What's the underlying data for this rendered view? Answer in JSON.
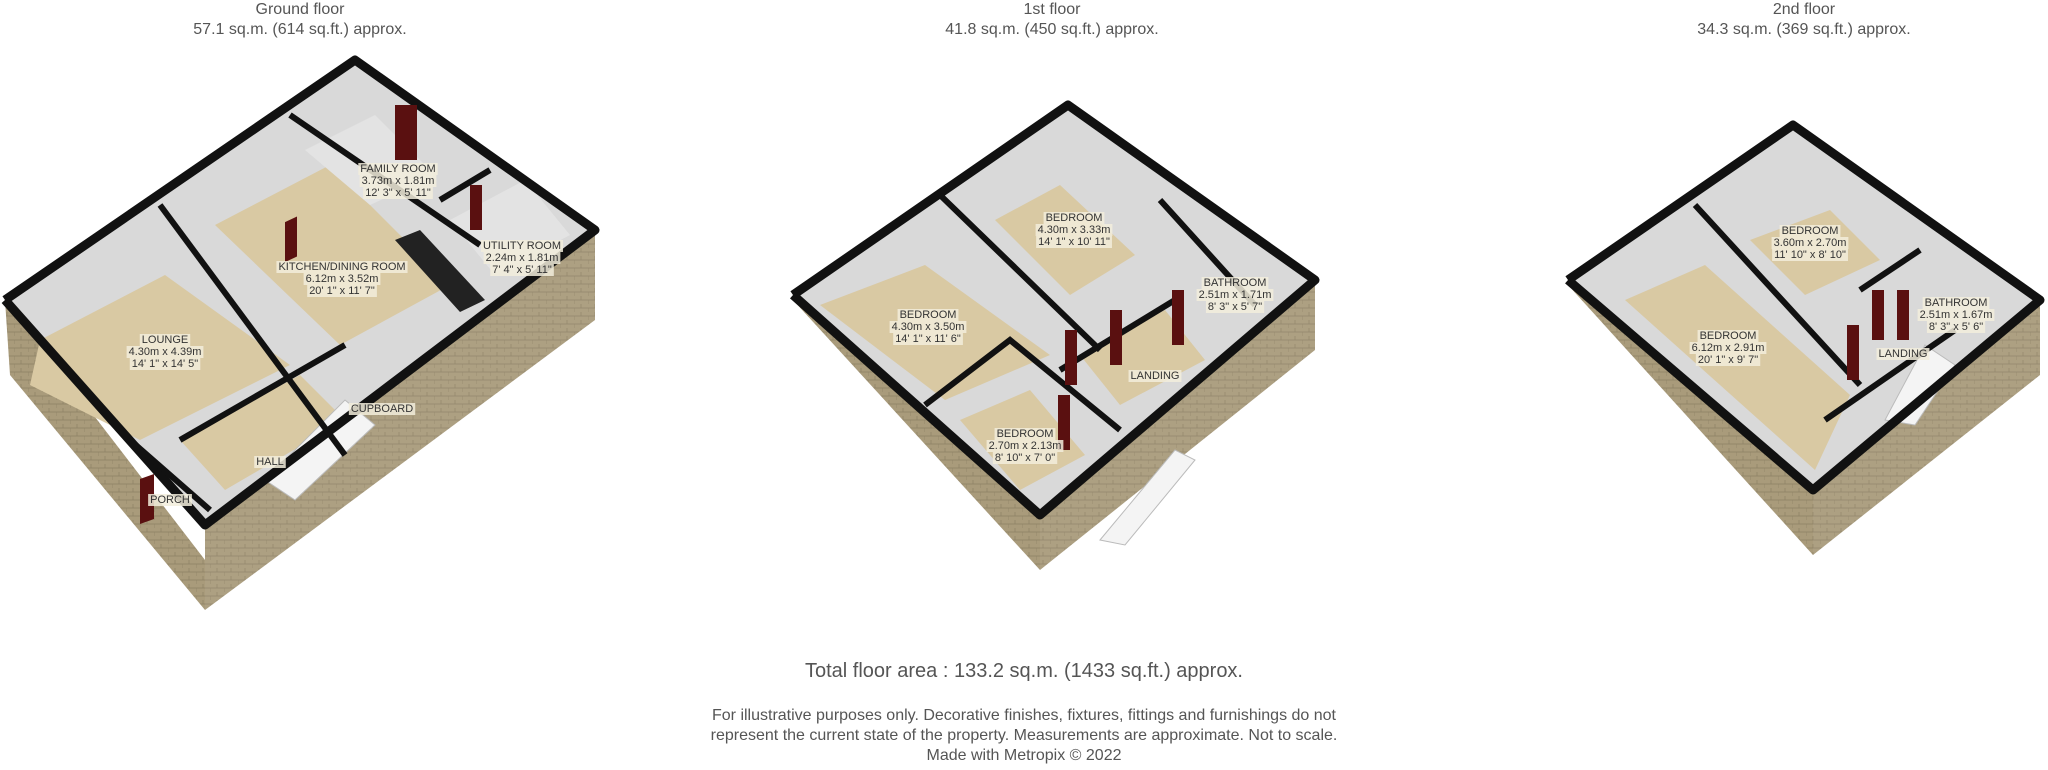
{
  "floors": [
    {
      "name": "Ground floor",
      "area": "57.1 sq.m. (614 sq.ft.) approx.",
      "rooms": [
        {
          "name": "FAMILY ROOM",
          "metric": "3.73m x 1.81m",
          "imperial": "12' 3\" x 5' 11\""
        },
        {
          "name": "UTILITY ROOM",
          "metric": "2.24m x 1.81m",
          "imperial": "7' 4\" x 5' 11\""
        },
        {
          "name": "KITCHEN/DINING ROOM",
          "metric": "6.12m x 3.52m",
          "imperial": "20' 1\" x 11' 7\""
        },
        {
          "name": "LOUNGE",
          "metric": "4.30m x 4.39m",
          "imperial": "14' 1\" x 14' 5\""
        },
        {
          "name": "CUPBOARD"
        },
        {
          "name": "HALL"
        },
        {
          "name": "PORCH"
        }
      ]
    },
    {
      "name": "1st floor",
      "area": "41.8 sq.m. (450 sq.ft.) approx.",
      "rooms": [
        {
          "name": "BEDROOM",
          "metric": "4.30m x 3.33m",
          "imperial": "14' 1\" x 10' 11\""
        },
        {
          "name": "BATHROOM",
          "metric": "2.51m x 1.71m",
          "imperial": "8' 3\" x 5' 7\""
        },
        {
          "name": "BEDROOM",
          "metric": "4.30m x 3.50m",
          "imperial": "14' 1\" x 11' 6\""
        },
        {
          "name": "LANDING"
        },
        {
          "name": "BEDROOM",
          "metric": "2.70m x 2.13m",
          "imperial": "8' 10\" x 7' 0\""
        }
      ]
    },
    {
      "name": "2nd floor",
      "area": "34.3 sq.m. (369 sq.ft.) approx.",
      "rooms": [
        {
          "name": "BEDROOM",
          "metric": "3.60m x 2.70m",
          "imperial": "11' 10\" x 8' 10\""
        },
        {
          "name": "BATHROOM",
          "metric": "2.51m x 1.67m",
          "imperial": "8' 3\" x 5' 6\""
        },
        {
          "name": "LANDING"
        },
        {
          "name": "BEDROOM",
          "metric": "6.12m x 2.91m",
          "imperial": "20' 1\" x 9' 7\""
        }
      ]
    }
  ],
  "footer": {
    "total": "Total floor area : 133.2 sq.m. (1433 sq.ft.) approx.",
    "disclaimer_line1": "For illustrative purposes only. Decorative finishes, fixtures, fittings and furnishings do not",
    "disclaimer_line2": "represent the current state of the property. Measurements are approximate. Not to scale.",
    "credit": "Made with Metropix © 2022"
  },
  "colors": {
    "brick": "#a89a7a",
    "floor": "#d9c9a3",
    "wall_inner": "#cfcfcf",
    "wall_top": "#111111",
    "door": "#5a1010"
  }
}
